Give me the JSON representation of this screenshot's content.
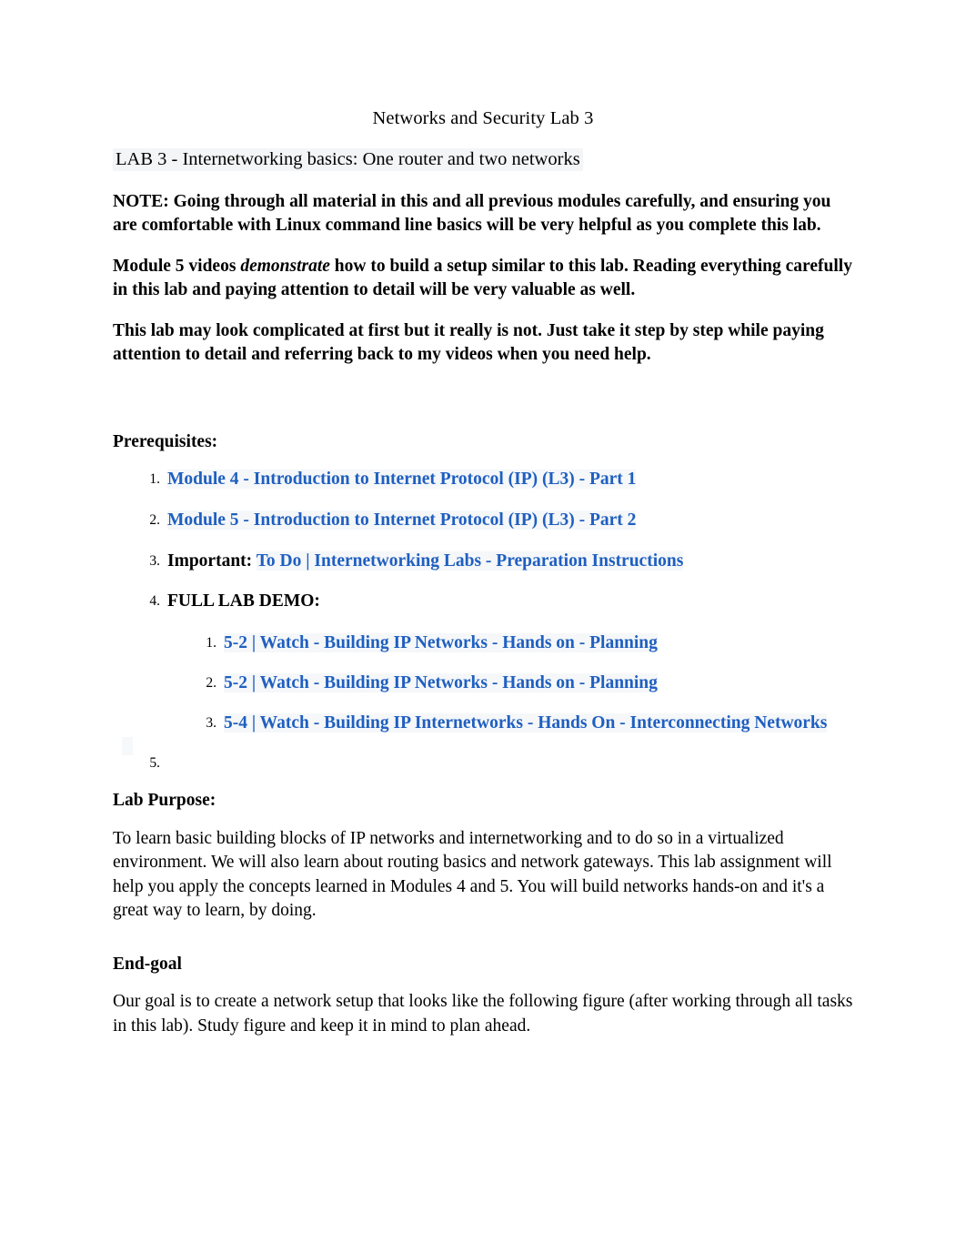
{
  "document": {
    "title": "Networks and Security Lab 3",
    "lab_heading": "LAB 3 - Internetworking basics: One router and two networks",
    "note_paragraph": "NOTE: Going through all material in this and all previous modules carefully, and ensuring you are comfortable with Linux command line basics will be very helpful as you complete this lab.",
    "module_paragraph": {
      "before_italic": "Module 5 videos ",
      "italic": "demonstrate",
      "after_italic": " how to build a setup similar to this lab. Reading everything carefully in this lab and paying attention to detail will be very valuable as well."
    },
    "complexity_paragraph": "This lab may look complicated at first but it really is not. Just take it step by step while paying attention to detail and referring back to my videos when you need help.",
    "prerequisites": {
      "heading": "Prerequisites:",
      "items": [
        {
          "type": "link",
          "text": "Module 4 - Introduction to Internet Protocol (IP) (L3) - Part 1"
        },
        {
          "type": "link",
          "text": "Module 5 - Introduction to Internet Protocol (IP) (L3) - Part 2"
        },
        {
          "type": "mixed",
          "prefix": "Important: ",
          "text": "To Do | Internetworking Labs - Preparation Instructions"
        },
        {
          "type": "heading",
          "text": "FULL LAB DEMO:"
        }
      ],
      "demo_items": [
        {
          "text": "5-2 | Watch - Building IP Networks - Hands on - Planning"
        },
        {
          "text": "5-2 | Watch - Building IP Networks - Hands on - Planning"
        },
        {
          "text": "5-4 | Watch - Building IP Internetworks - Hands On - Interconnecting Networks"
        }
      ]
    },
    "lab_purpose": {
      "heading": "Lab Purpose:",
      "body": "To learn basic building blocks of IP networks and internetworking and to do so in a virtualized environment. We will also learn about routing basics and network gateways. This lab assignment will help you apply the concepts learned in Modules 4 and 5. You will build networks hands-on and it's a great way to learn, by doing."
    },
    "end_goal": {
      "heading": "End-goal",
      "body": "Our goal is to create a network setup that looks like the following figure (after working through all tasks in this lab). Study figure and keep it in mind to plan ahead."
    },
    "colors": {
      "link": "#1f5fc0",
      "text": "#000000",
      "highlight": "#f4f5f6",
      "page_background": "#ffffff"
    }
  }
}
